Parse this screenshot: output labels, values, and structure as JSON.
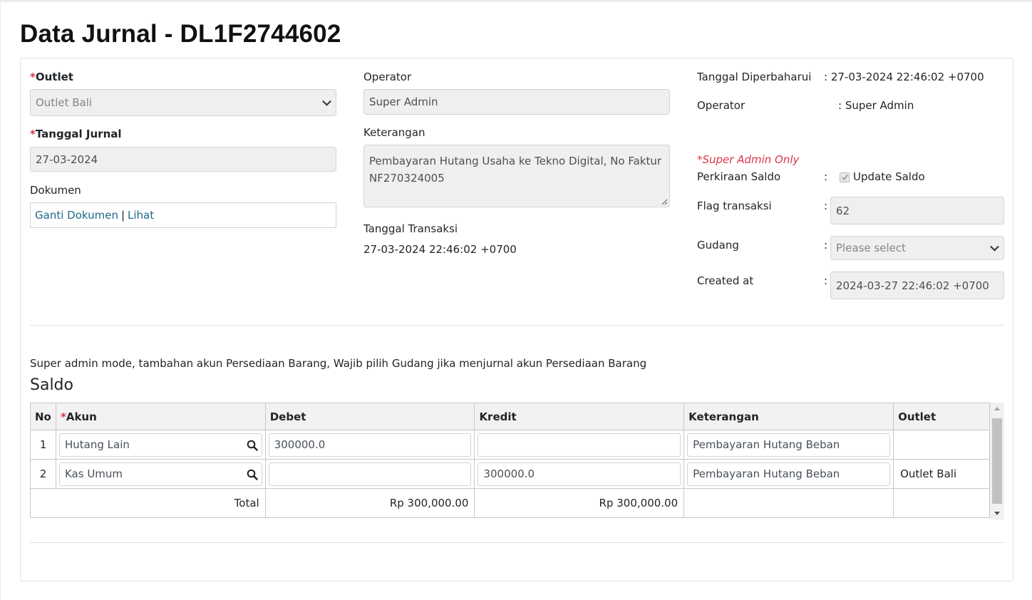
{
  "page": {
    "title": "Data Jurnal - DL1F2744602"
  },
  "left": {
    "outlet_label": "Outlet",
    "outlet_value": "Outlet Bali",
    "tanggal_label": "Tanggal Jurnal",
    "tanggal_value": "27-03-2024",
    "dokumen_label": "Dokumen",
    "ganti_link": "Ganti Dokumen",
    "separator": "|",
    "lihat_link": "Lihat"
  },
  "middle": {
    "operator_label": "Operator",
    "operator_value": "Super Admin",
    "keterangan_label": "Keterangan",
    "keterangan_value": "Pembayaran Hutang Usaha ke Tekno Digital, No Faktur NF270324005",
    "tgl_transaksi_label": "Tanggal Transaksi",
    "tgl_transaksi_value": "27-03-2024 22:46:02 +0700"
  },
  "right": {
    "diperbaharui_label": "Tanggal Diperbaharui",
    "diperbaharui_value": ": 27-03-2024 22:46:02 +0700",
    "operator_label": "Operator",
    "operator_value": ": Super Admin",
    "super_admin_note": "*Super Admin Only",
    "perkiraan_label": "Perkiraan Saldo",
    "colon": ":",
    "update_saldo_label": "Update Saldo",
    "update_saldo_checked": true,
    "flag_label": "Flag transaksi",
    "flag_value": "62",
    "gudang_label": "Gudang",
    "gudang_placeholder": "Please select",
    "created_label": "Created at",
    "created_value": "2024-03-27 22:46:02 +0700"
  },
  "saldo": {
    "info_text": "Super admin mode, tambahan akun Persediaan Barang, Wajib pilih Gudang jika menjurnal akun Persediaan Barang",
    "heading": "Saldo",
    "columns": {
      "no": "No",
      "akun": "Akun",
      "debet": "Debet",
      "kredit": "Kredit",
      "keterangan": "Keterangan",
      "outlet": "Outlet"
    },
    "rows": [
      {
        "no": "1",
        "akun": "Hutang Lain",
        "debet": "300000.0",
        "kredit": "",
        "keterangan": "Pembayaran Hutang Beban",
        "outlet": ""
      },
      {
        "no": "2",
        "akun": "Kas Umum",
        "debet": "",
        "kredit": "300000.0",
        "keterangan": "Pembayaran Hutang Beban",
        "outlet": "Outlet Bali"
      }
    ],
    "total_label": "Total",
    "total_debet": "Rp 300,000.00",
    "total_kredit": "Rp 300,000.00"
  },
  "colors": {
    "required": "#dc3545",
    "link": "#1d6a8a",
    "readonly_bg": "#f1efed"
  },
  "icons": {
    "akun_search": "search-icon",
    "select_caret": "chevron-down-icon",
    "checkbox": "checkmark-icon"
  }
}
